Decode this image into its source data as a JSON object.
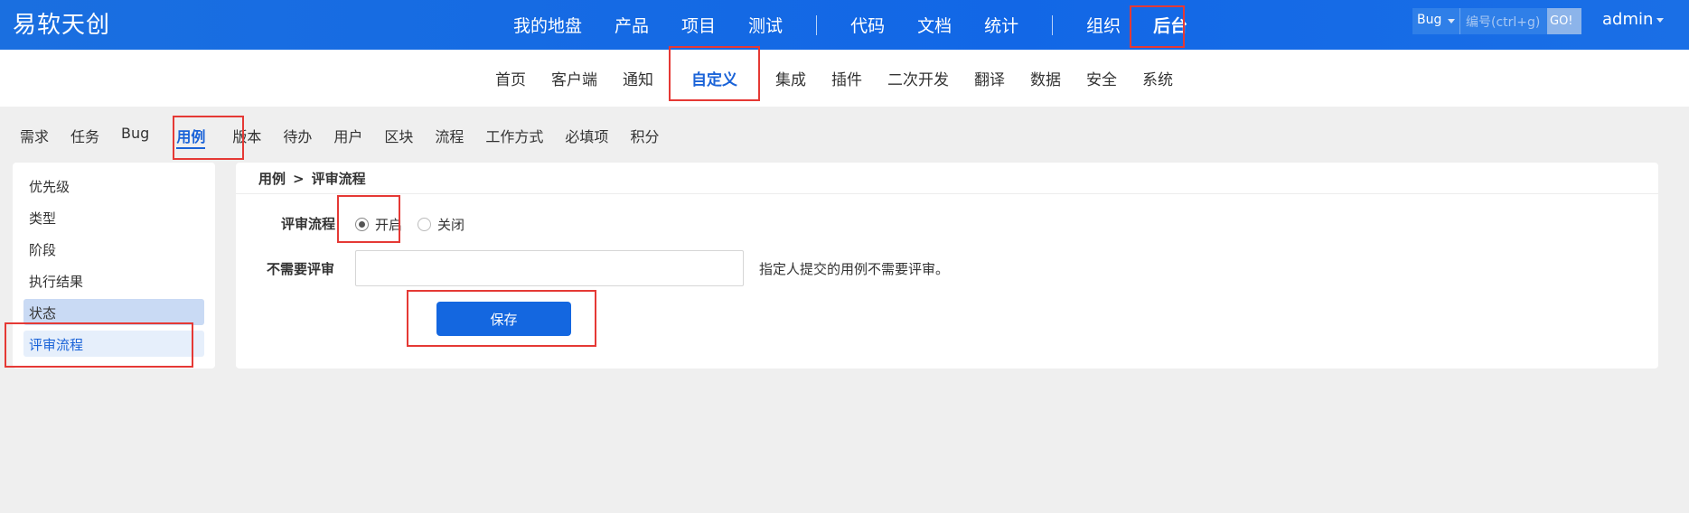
{
  "header": {
    "logo": "易软天创",
    "nav": [
      "我的地盘",
      "产品",
      "项目",
      "测试",
      "代码",
      "文档",
      "统计",
      "组织",
      "后台"
    ],
    "search": {
      "type": "Bug",
      "placeholder": "编号(ctrl+g)",
      "go": "GO!"
    },
    "user": "admin"
  },
  "subnav": [
    "首页",
    "客户端",
    "通知",
    "自定义",
    "集成",
    "插件",
    "二次开发",
    "翻译",
    "数据",
    "安全",
    "系统"
  ],
  "module_tabs": [
    "需求",
    "任务",
    "Bug",
    "用例",
    "版本",
    "待办",
    "用户",
    "区块",
    "流程",
    "工作方式",
    "必填项",
    "积分"
  ],
  "side_menu": [
    "优先级",
    "类型",
    "阶段",
    "执行结果",
    "状态",
    "评审流程"
  ],
  "breadcrumb": {
    "parent": "用例",
    "current": "评审流程"
  },
  "form": {
    "review_label": "评审流程",
    "radio_on": "开启",
    "radio_off": "关闭",
    "no_review_label": "不需要评审",
    "no_review_hint": "指定人提交的用例不需要评审。",
    "save": "保存"
  },
  "colors": {
    "primary": "#1467e0",
    "highlight": "#e53935"
  }
}
